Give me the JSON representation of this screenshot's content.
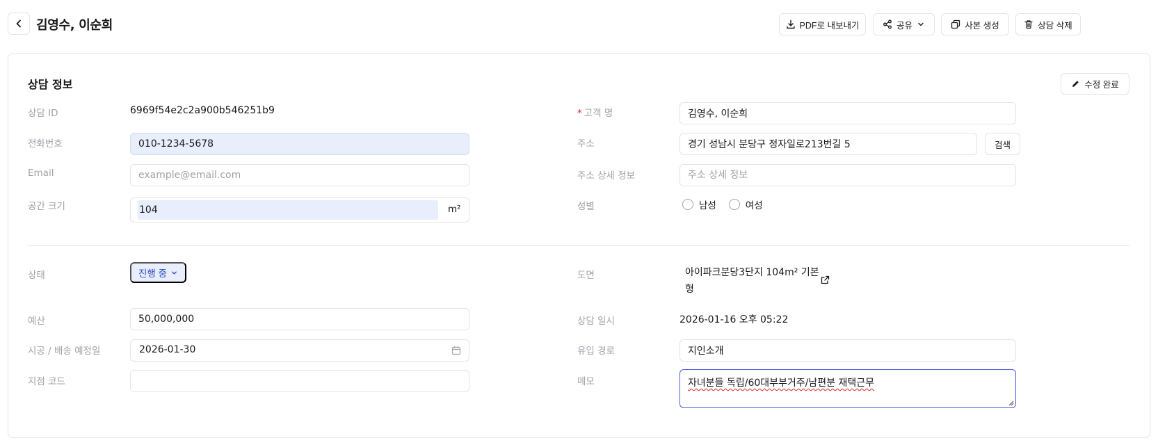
{
  "header": {
    "title": "김영수, 이순희",
    "actions": {
      "pdf": "PDF로 내보내기",
      "share": "공유",
      "copy": "사본 생성",
      "delete": "상담 삭제"
    }
  },
  "section": {
    "title": "상담 정보",
    "edit_done": "수정 완료"
  },
  "labels": {
    "consult_id": "상담 ID",
    "phone": "전화번호",
    "email": "Email",
    "space_size": "공간 크기",
    "customer_name": "고객 명",
    "address": "주소",
    "address_detail": "주소 상세 정보",
    "gender": "성별",
    "status": "상태",
    "budget": "예산",
    "schedule": "시공 / 배송 예정일",
    "branch_code": "지점 코드",
    "drawing": "도면",
    "consult_datetime": "상담 일시",
    "inflow": "유입 경로",
    "memo": "메모"
  },
  "values": {
    "consult_id": "6969f54e2c2a900b546251b9",
    "phone": "010-1234-5678",
    "email": "",
    "space_size": "104",
    "space_unit": "m²",
    "customer_name": "김영수, 이순희",
    "address": "경기 성남시 분당구 정자일로213번길 5",
    "address_detail": "",
    "status": "진행 중",
    "budget": "50,000,000",
    "schedule": "2026-01-30",
    "branch_code": "",
    "drawing": "아이파크분당3단지 104m² 기본형",
    "consult_datetime": "2026-01-16 오후 05:22",
    "inflow": "지인소개",
    "memo": "자녀분들 독립/60대부부거주/남편분 재택근무"
  },
  "placeholders": {
    "email": "example@email.com",
    "address_detail": "주소 상세 정보"
  },
  "buttons": {
    "search": "검색"
  },
  "gender_options": [
    "남성",
    "여성"
  ],
  "colors": {
    "highlight_bg": "#e8eefc",
    "status_text": "#3046c0",
    "required": "#dc2626",
    "memo_border": "#4b5bd6"
  }
}
